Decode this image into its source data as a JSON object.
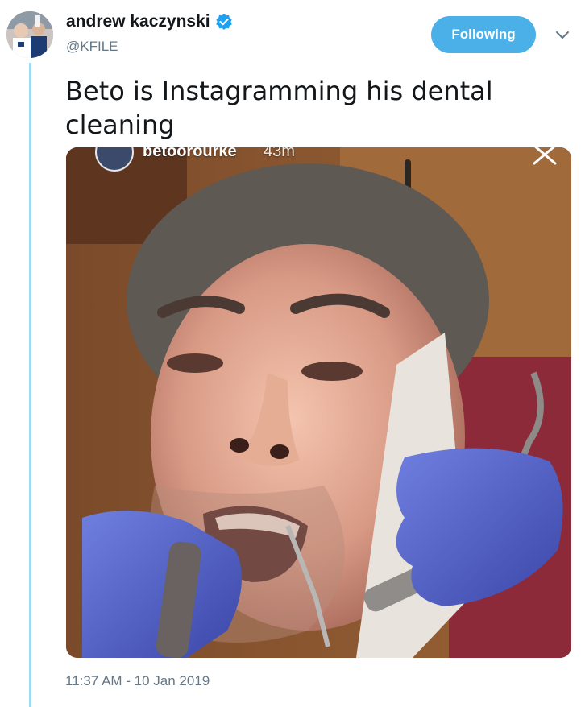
{
  "author": {
    "display_name": "andrew kaczynski",
    "handle": "@KFILE",
    "verified": true
  },
  "follow_button": {
    "label": "Following"
  },
  "tweet": {
    "text": "Beto is Instagramming his dental cleaning",
    "timestamp": "11:37 AM - 10 Jan 2019"
  },
  "media": {
    "story_username": "betoorourke",
    "story_age": "43m"
  },
  "colors": {
    "accent": "#4bb0e8",
    "thread_line": "#9fd8f1",
    "muted_text": "#657786"
  },
  "icons": {
    "verified": "verified-badge-icon",
    "menu": "chevron-down-icon",
    "close": "close-icon"
  }
}
